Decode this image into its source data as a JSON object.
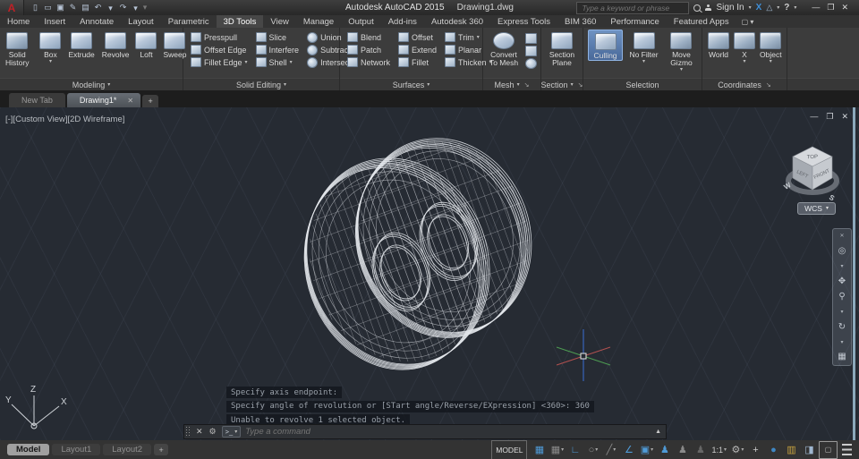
{
  "titlebar": {
    "app_title": "Autodesk AutoCAD 2015",
    "doc_title": "Drawing1.dwg",
    "search_placeholder": "Type a keyword or phrase",
    "sign_in_label": "Sign In"
  },
  "menu_tabs": [
    "Home",
    "Insert",
    "Annotate",
    "Layout",
    "Parametric",
    "3D Tools",
    "View",
    "Manage",
    "Output",
    "Add-ins",
    "Autodesk 360",
    "Express Tools",
    "BIM 360",
    "Performance",
    "Featured Apps"
  ],
  "ribbon": {
    "modeling": {
      "label": "Modeling",
      "solid_history": "Solid History",
      "box": "Box",
      "extrude": "Extrude",
      "revolve": "Revolve",
      "loft": "Loft",
      "sweep": "Sweep"
    },
    "solid_editing": {
      "label": "Solid Editing",
      "col1": [
        "Presspull",
        "Offset Edge",
        "Fillet Edge"
      ],
      "col2": [
        "Slice",
        "Interfere",
        "Shell"
      ],
      "col3": [
        "Union",
        "Subtract",
        "Intersect"
      ]
    },
    "surfaces": {
      "label": "Surfaces",
      "col1": [
        "Blend",
        "Patch",
        "Network"
      ],
      "col2": [
        "Offset",
        "Extend",
        "Fillet"
      ],
      "col3": [
        "Trim",
        "Planar",
        "Thicken"
      ]
    },
    "mesh": {
      "label": "Mesh",
      "convert": "Convert To Mesh"
    },
    "section": {
      "label": "Section",
      "plane": "Section Plane"
    },
    "selection": {
      "label": "Selection",
      "culling": "Culling",
      "no_filter": "No Filter",
      "move_gizmo": "Move Gizmo"
    },
    "coordinates": {
      "label": "Coordinates",
      "world": "World",
      "x": "X",
      "object": "Object"
    }
  },
  "file_tabs": {
    "new_tab": "New Tab",
    "drawing": "Drawing1*"
  },
  "viewport": {
    "label": "[-][Custom View][2D Wireframe]",
    "cube_top": "TOP",
    "cube_left": "LEFT",
    "cube_front": "FRONT",
    "compass_w": "W",
    "compass_s": "S",
    "wcs_label": "WCS"
  },
  "command_history": {
    "line1": "Specify axis endpoint:",
    "line2": "Specify angle of revolution or [STart angle/Reverse/EXpression] <360>: 360",
    "line3": "Unable to revolve 1 selected object."
  },
  "command_line": {
    "placeholder": "Type a command"
  },
  "layout_tabs": [
    "Model",
    "Layout1",
    "Layout2"
  ],
  "status_bar": {
    "model_label": "MODEL",
    "scale": "1:1"
  }
}
